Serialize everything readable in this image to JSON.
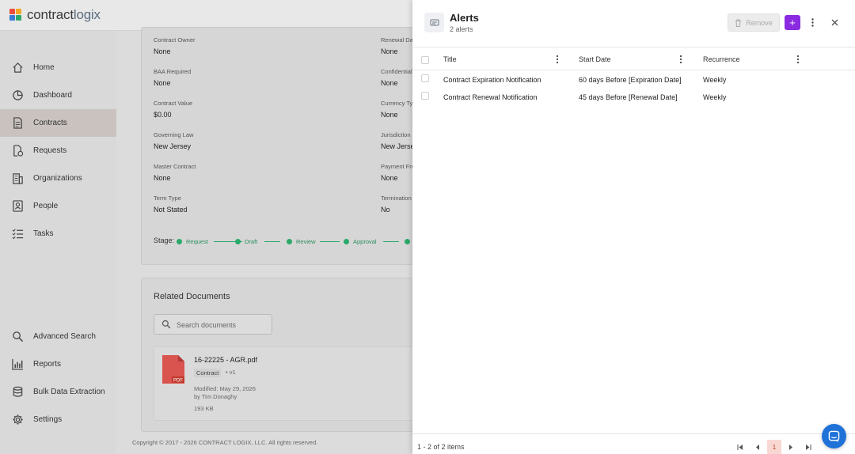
{
  "logo": {
    "part1": "contract",
    "part2": "logix"
  },
  "sidebar": {
    "items": [
      {
        "label": "Home",
        "icon": "home-icon"
      },
      {
        "label": "Dashboard",
        "icon": "dashboard-icon"
      },
      {
        "label": "Contracts",
        "icon": "contracts-icon",
        "active": true
      },
      {
        "label": "Requests",
        "icon": "requests-icon"
      },
      {
        "label": "Organizations",
        "icon": "organizations-icon"
      },
      {
        "label": "People",
        "icon": "people-icon"
      },
      {
        "label": "Tasks",
        "icon": "tasks-icon"
      }
    ],
    "bottom_items": [
      {
        "label": "Advanced Search",
        "icon": "search-icon"
      },
      {
        "label": "Reports",
        "icon": "reports-icon"
      },
      {
        "label": "Bulk Data Extraction",
        "icon": "database-icon"
      },
      {
        "label": "Settings",
        "icon": "gear-icon"
      }
    ]
  },
  "details": {
    "left": [
      {
        "label": "Contract Owner",
        "value": "None"
      },
      {
        "label": "BAA Required",
        "value": "None"
      },
      {
        "label": "Contract Value",
        "value": "$0.00"
      },
      {
        "label": "Governing Law",
        "value": "New Jersey"
      },
      {
        "label": "Master Contract",
        "value": "None"
      },
      {
        "label": "Term Type",
        "value": "Not Stated"
      }
    ],
    "right": [
      {
        "label": "Renewal Dat",
        "value": "None"
      },
      {
        "label": "Confidential",
        "value": "None"
      },
      {
        "label": "Currency Ty",
        "value": "None"
      },
      {
        "label": "Jurisdiction",
        "value": "New Jerse"
      },
      {
        "label": "Payment Fre",
        "value": "None"
      },
      {
        "label": "Termination",
        "value": "No"
      }
    ],
    "stage_label": "Stage:",
    "stages": [
      "Request",
      "Draft",
      "Review",
      "Approval"
    ]
  },
  "related": {
    "title": "Related Documents",
    "search_placeholder": "Search documents",
    "document": {
      "name": "16-22225 - AGR.pdf",
      "type": "Contract",
      "version": "v1",
      "modified": "Modified: May 29, 2026",
      "by": "by Tim Donaghy",
      "size": "193 KB",
      "icon_label": "PDF"
    }
  },
  "footer": {
    "copyright": "Copyright © 2017 - 2026 CONTRACT LOGIX, LLC. All rights reserved."
  },
  "drawer": {
    "title": "Alerts",
    "subtitle": "2 alerts",
    "remove_label": "Remove",
    "add_label": "+",
    "columns": [
      "Title",
      "Start Date",
      "Recurrence"
    ],
    "rows": [
      {
        "title": "Contract Expiration Notification",
        "start": "60 days Before [Expiration Date]",
        "recurrence": "Weekly"
      },
      {
        "title": "Contract Renewal Notification",
        "start": "45 days Before [Renewal Date]",
        "recurrence": "Weekly"
      }
    ],
    "pager_info": "1 - 2 of 2 items",
    "current_page": "1"
  },
  "colors": {
    "accent": "#8a2be2",
    "stage": "#2aa96a",
    "chat": "#1f72d8"
  }
}
